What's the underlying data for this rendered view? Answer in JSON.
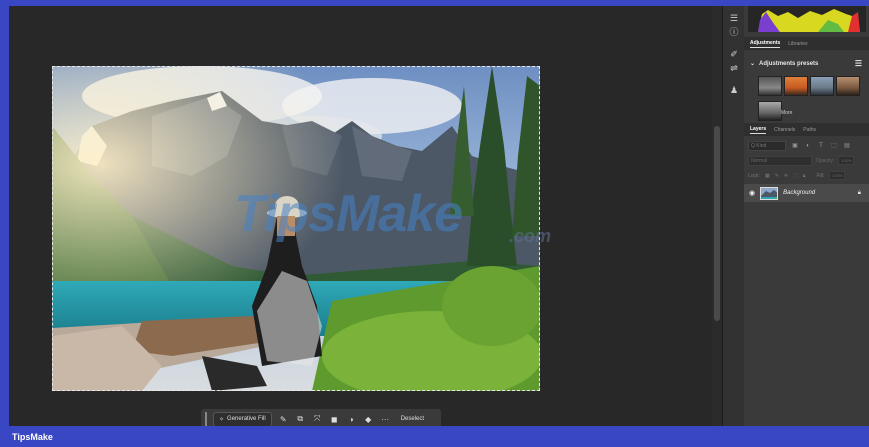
{
  "context_bar": {
    "generative_fill_label": "Generative Fill",
    "more_label": "···",
    "deselect_label": "Deselect"
  },
  "watermark": {
    "main": "TipsMake",
    "suffix": ".com"
  },
  "panels": {
    "top_tabs": [
      "Adjustments",
      "Libraries"
    ],
    "adjustments_presets_label": "Adjustments presets",
    "more_label": "More",
    "layer_tabs": [
      "Layers",
      "Channels",
      "Paths"
    ],
    "search_placeholder": "Q Kind",
    "blend_mode": "Normal",
    "opacity_label": "Opacity:",
    "opacity_value": "100%",
    "lock_label": "Lock:",
    "fill_label": "Fill:",
    "fill_value": "100%",
    "layer_name": "Background"
  },
  "footer": {
    "brand": "TipsMake"
  },
  "colors": {
    "frame_blue": "#3a47c4",
    "canvas_bg": "#282828",
    "panel_bg": "#3a3a3a"
  },
  "icons": {
    "strip": [
      "sliders-icon",
      "info-icon",
      "brush-settings-icon",
      "properties-icon",
      "stamp-icon"
    ],
    "context": [
      "brush-icon",
      "transform-icon",
      "crop-select-icon",
      "mask-icon",
      "adjust-icon",
      "fill-icon"
    ]
  }
}
